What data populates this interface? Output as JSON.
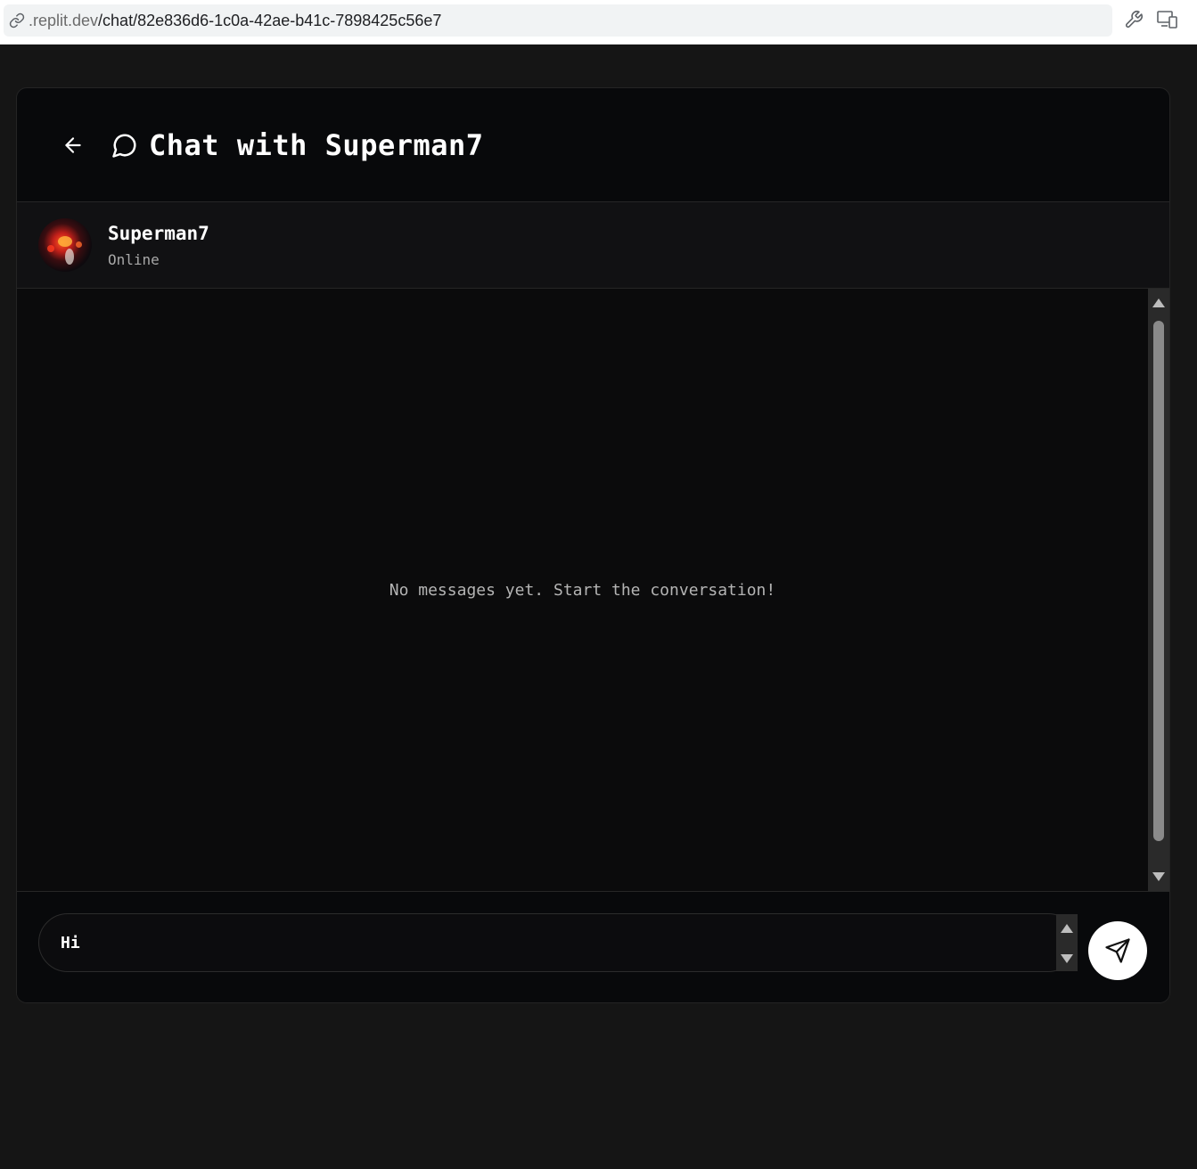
{
  "browser": {
    "url_host": ".replit.dev",
    "url_path": "/chat/82e836d6-1c0a-42ae-b41c-7898425c56e7",
    "icons": [
      "link-icon",
      "wrench-icon",
      "devices-icon",
      "panel-icon"
    ]
  },
  "header": {
    "back_icon": "arrow-left-icon",
    "chat_icon": "message-circle-icon",
    "title": "Chat with Superman7"
  },
  "contact": {
    "name": "Superman7",
    "status": "Online"
  },
  "messages": {
    "empty_text": "No messages yet. Start the conversation!"
  },
  "composer": {
    "input_value": "Hi",
    "send_icon": "send-icon"
  },
  "colors": {
    "page_bg": "#151515",
    "card_bg": "#08090b",
    "panel_bg": "#111113",
    "messages_bg": "#0b0b0c",
    "send_button_bg": "#ffffff"
  }
}
